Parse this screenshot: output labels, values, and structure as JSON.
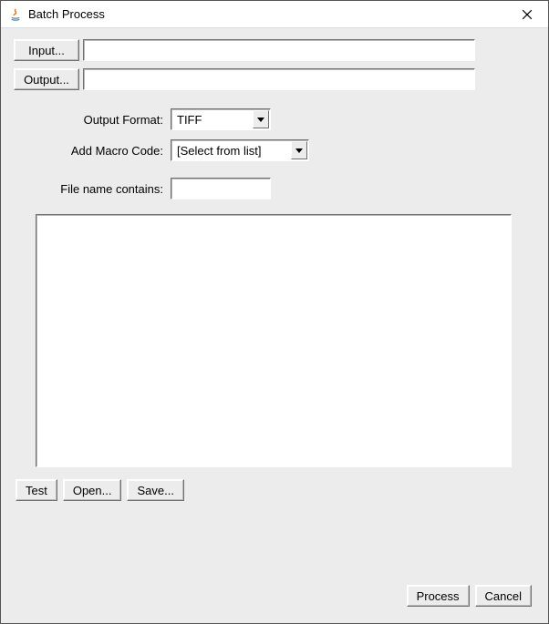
{
  "window": {
    "title": "Batch Process"
  },
  "buttons": {
    "input": "Input...",
    "output": "Output...",
    "test": "Test",
    "open": "Open...",
    "save": "Save...",
    "process": "Process",
    "cancel": "Cancel"
  },
  "labels": {
    "output_format": "Output Format:",
    "add_macro": "Add Macro Code:",
    "filename_contains": "File name contains:"
  },
  "fields": {
    "input_path": "",
    "output_path": "",
    "output_format": "TIFF",
    "macro_selected": "[Select from list]",
    "filename_contains": "",
    "macro_text": ""
  }
}
